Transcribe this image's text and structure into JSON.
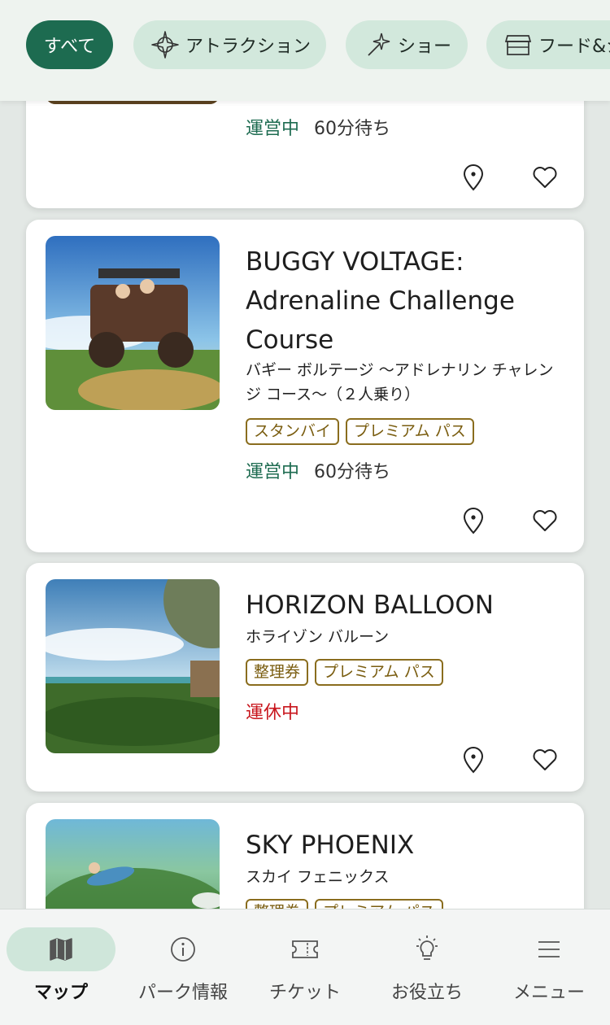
{
  "filters": [
    {
      "label": "すべて",
      "icon": "all",
      "active": true
    },
    {
      "label": "アトラクション",
      "icon": "compass-icon",
      "active": false
    },
    {
      "label": "ショー",
      "icon": "sparkle-icon",
      "active": false
    },
    {
      "label": "フード&ショ",
      "icon": "shop-icon",
      "active": false
    }
  ],
  "cards": [
    {
      "status": "運営中",
      "wait": "60分待ち"
    },
    {
      "title": "BUGGY VOLTAGE: Adrenaline Challenge Course",
      "subtitle": "バギー ボルテージ 〜アドレナリン チャレンジ コース〜（２人乗り）",
      "tags": [
        "スタンバイ",
        "プレミアム パス"
      ],
      "status": "運営中",
      "wait": "60分待ち"
    },
    {
      "title": "HORIZON BALLOON",
      "subtitle": "ホライゾン バルーン",
      "tags": [
        "整理券",
        "プレミアム パス"
      ],
      "status": "運休中"
    },
    {
      "title": "SKY PHOENIX",
      "subtitle": "スカイ フェニックス",
      "tags": [
        "整理券",
        "プレミアム パス"
      ]
    }
  ],
  "nav": [
    {
      "label": "マップ",
      "icon": "map-icon",
      "active": true
    },
    {
      "label": "パーク情報",
      "icon": "info-icon",
      "active": false
    },
    {
      "label": "チケット",
      "icon": "ticket-icon",
      "active": false
    },
    {
      "label": "お役立ち",
      "icon": "lightbulb-icon",
      "active": false
    },
    {
      "label": "メニュー",
      "icon": "menu-icon",
      "active": false
    }
  ],
  "colors": {
    "accent": "#1d6b50",
    "open": "#1d6b50",
    "closed": "#c8161d",
    "tag": "#8a6d1e",
    "chip": "#d2e8dc"
  }
}
